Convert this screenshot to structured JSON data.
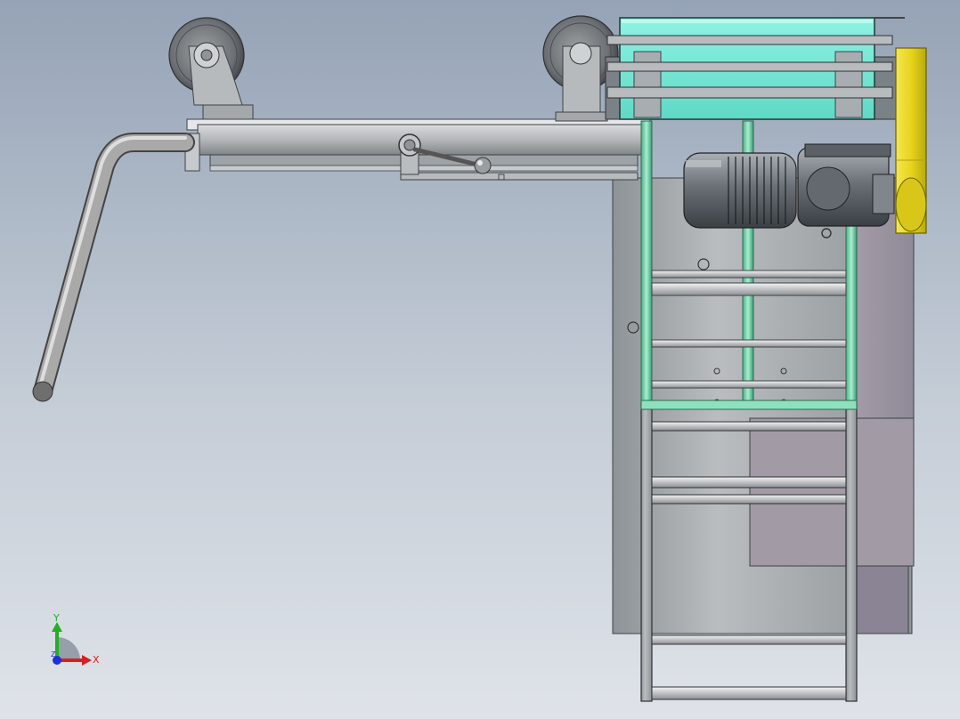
{
  "viewport": {
    "background_top": "#95a3b6",
    "background_bottom": "#dfe3e9"
  },
  "model": {
    "components": [
      "caster-wheel-left",
      "caster-wheel-right",
      "boom-arm",
      "handwheel-crank",
      "clamp-lever",
      "drive-motor",
      "gearbox",
      "cyan-frame-guard",
      "yellow-belt-guard",
      "support-column",
      "side-ladder"
    ],
    "colors": {
      "steel": "#a9aeb2",
      "dark_steel": "#5f666c",
      "guard_cyan": "#76ead8",
      "guard_yellow": "#ecdc22",
      "rail_green": "#6fcfa6",
      "motor_gray": "#7a8086"
    }
  },
  "triad": {
    "x_label": "X",
    "y_label": "Y",
    "z_label": "Z",
    "x_color": "#d42020",
    "y_color": "#22b022",
    "z_color": "#1d2fd8"
  }
}
